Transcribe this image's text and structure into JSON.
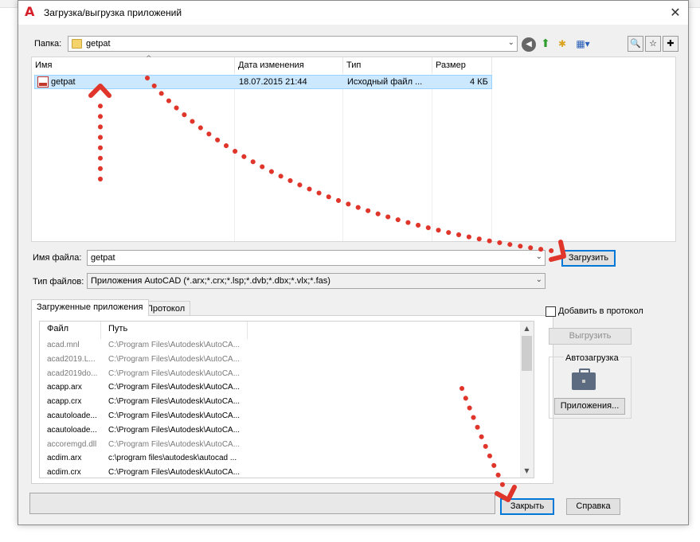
{
  "window": {
    "title": "Загрузка/выгрузка приложений",
    "close": "✕"
  },
  "folder": {
    "label": "Папка:",
    "value": "getpat"
  },
  "file_list": {
    "columns": [
      "Имя",
      "Дата изменения",
      "Тип",
      "Размер"
    ],
    "rows": [
      {
        "name": "getpat",
        "date": "18.07.2015 21:44",
        "type": "Исходный файл ...",
        "size": "4 КБ"
      }
    ]
  },
  "filename": {
    "label": "Имя файла:",
    "value": "getpat"
  },
  "filetype": {
    "label": "Тип файлов:",
    "value": "Приложения AutoCAD (*.arx;*.crx;*.lsp;*.dvb;*.dbx;*.vlx;*.fas)"
  },
  "load_button": "Загрузить",
  "tabs": [
    "Загруженные приложения",
    "Протокол"
  ],
  "loaded_apps": {
    "columns": [
      "Файл",
      "Путь"
    ],
    "rows": [
      {
        "file": "acad.mnl",
        "path": "C:\\Program Files\\Autodesk\\AutoCA...",
        "grey": true
      },
      {
        "file": "acad2019.L...",
        "path": "C:\\Program Files\\Autodesk\\AutoCA...",
        "grey": true
      },
      {
        "file": "acad2019do...",
        "path": "C:\\Program Files\\Autodesk\\AutoCA...",
        "grey": true
      },
      {
        "file": "acapp.arx",
        "path": "C:\\Program Files\\Autodesk\\AutoCA...",
        "grey": false
      },
      {
        "file": "acapp.crx",
        "path": "C:\\Program Files\\Autodesk\\AutoCA...",
        "grey": false
      },
      {
        "file": "acautoloade...",
        "path": "C:\\Program Files\\Autodesk\\AutoCA...",
        "grey": false
      },
      {
        "file": "acautoloade...",
        "path": "C:\\Program Files\\Autodesk\\AutoCA...",
        "grey": false
      },
      {
        "file": "accoremgd.dll",
        "path": "C:\\Program Files\\Autodesk\\AutoCA...",
        "grey": true
      },
      {
        "file": "acdim.arx",
        "path": "c:\\program files\\autodesk\\autocad ...",
        "grey": false
      },
      {
        "file": "acdim.crx",
        "path": "C:\\Program Files\\Autodesk\\AutoCA...",
        "grey": false
      }
    ]
  },
  "add_to_history": {
    "label": "Добавить в протокол",
    "checked": false
  },
  "unload_button": "Выгрузить",
  "startup_group": {
    "label": "Автозагрузка",
    "button": "Приложения..."
  },
  "close_button": "Закрыть",
  "help_button": "Справка",
  "colors": {
    "accent": "#0078d7",
    "selection": "#cce8ff",
    "annotation": "#e0352b"
  }
}
